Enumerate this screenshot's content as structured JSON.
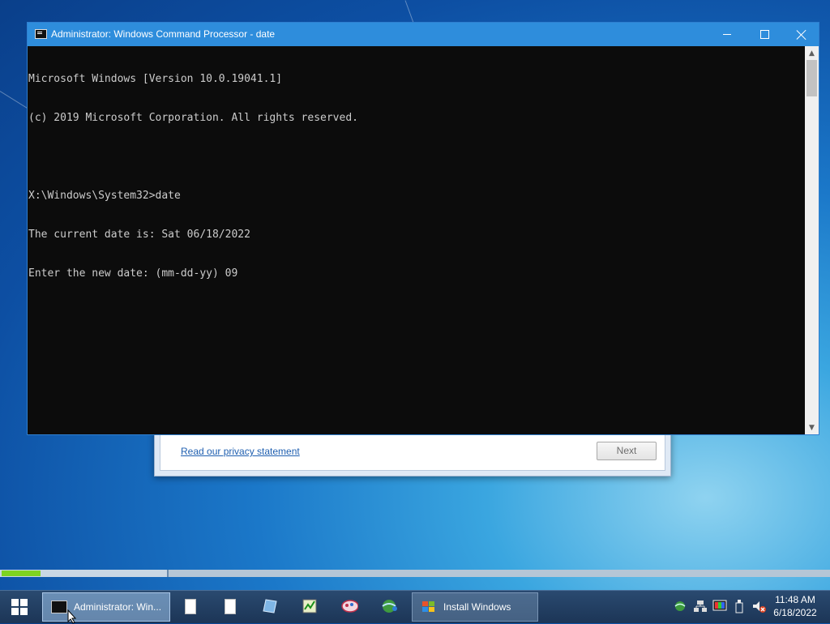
{
  "console_window": {
    "title": "Administrator: Windows Command Processor - date",
    "lines": [
      "Microsoft Windows [Version 10.0.19041.1]",
      "(c) 2019 Microsoft Corporation. All rights reserved.",
      "",
      "X:\\Windows\\System32>date",
      "The current date is: Sat 06/18/2022",
      "Enter the new date: (mm-dd-yy) 09"
    ]
  },
  "install_dialog": {
    "privacy_link": "Read our privacy statement",
    "next_label": "Next"
  },
  "taskbar": {
    "cmd_task_label": "Administrator: Win...",
    "install_task_label": "Install Windows",
    "clock_time": "11:48 AM",
    "clock_date": "6/18/2022"
  },
  "progress": {
    "fraction": 0.24
  },
  "colors": {
    "console_bg": "#0c0c0c",
    "console_text": "#cccccc",
    "titlebar": "#2e8ddc",
    "progress_fill": "#7ed321"
  }
}
